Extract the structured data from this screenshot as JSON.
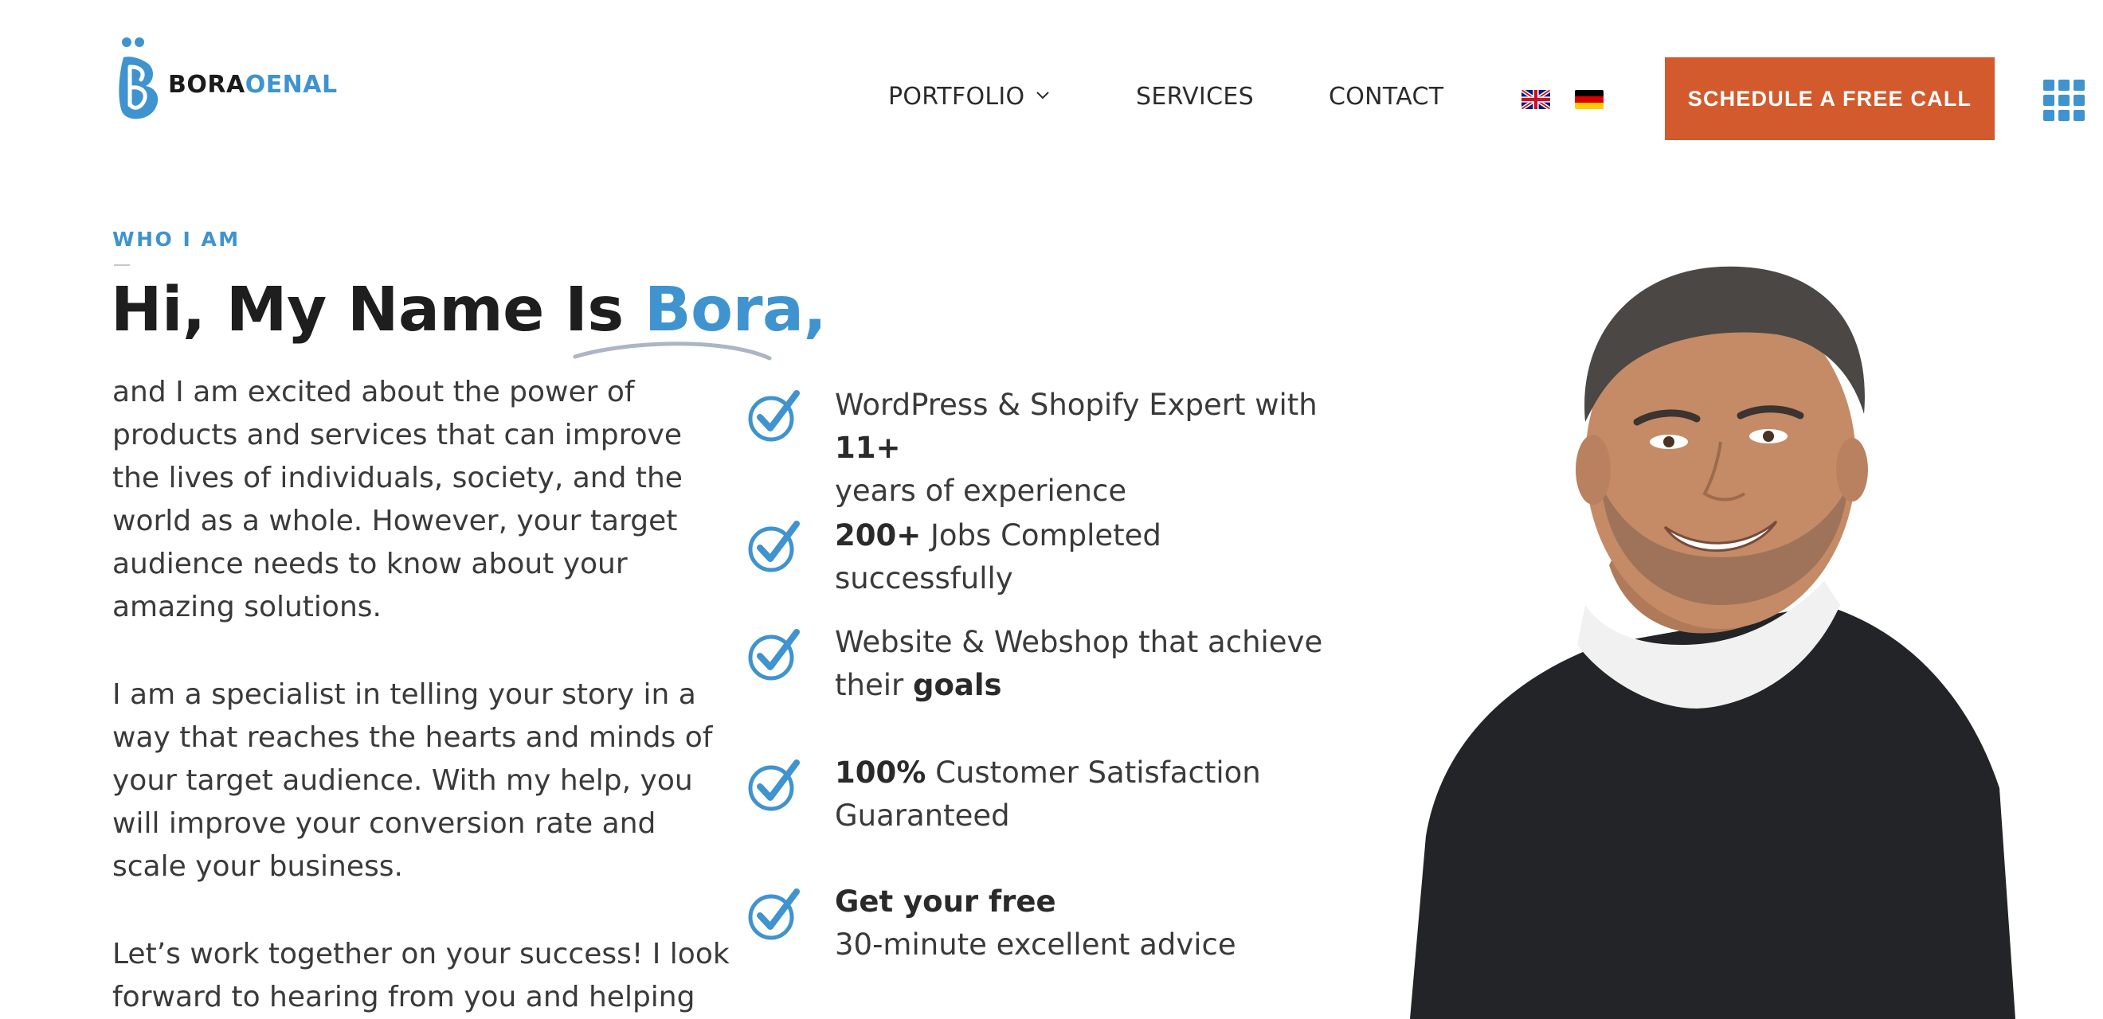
{
  "header": {
    "logo": {
      "part1": "BORA",
      "part2": "OENAL"
    },
    "nav": {
      "portfolio": "PORTFOLIO",
      "services": "SERVICES",
      "contact": "CONTACT"
    },
    "languages": [
      "English",
      "Deutsch"
    ],
    "cta_label": "SCHEDULE A FREE CALL"
  },
  "hero": {
    "eyebrow": "WHO I AM",
    "headline_prefix": "Hi, My Name Is ",
    "headline_name": "Bora,",
    "paragraphs": [
      "and I am excited about the power of products and services that can improve the lives of individuals, society, and the world as a whole. However, your target audience needs to know about your amazing solutions.",
      "I am a specialist in telling your story in a way that reaches the hearts and minds of your target audience. With my help, you will improve your conversion rate and scale your business.",
      "Let’s work together on your success! I look forward to hearing from you and helping"
    ]
  },
  "checklist": [
    {
      "pre": "WordPress & Shopify Expert with ",
      "bold": "11+",
      "post": " years of experience"
    },
    {
      "pre": "",
      "bold": "200+",
      "post": " Jobs Completed successfully"
    },
    {
      "pre": "Website & Webshop that achieve their ",
      "bold": "goals",
      "post": ""
    },
    {
      "pre": "",
      "bold": "100%",
      "post": " Customer Satisfaction Guaranteed"
    },
    {
      "pre": "",
      "bold": "Get your free",
      "post": "30-minute excellent advice"
    }
  ],
  "colors": {
    "brand_blue": "#3f93cf",
    "cta_orange": "#d35a2d",
    "text_dark": "#1e1e1e"
  },
  "icons": [
    "logo-mark",
    "chevron-down-icon",
    "uk-flag-icon",
    "de-flag-icon",
    "grid-menu-icon",
    "checkmark-icon"
  ]
}
